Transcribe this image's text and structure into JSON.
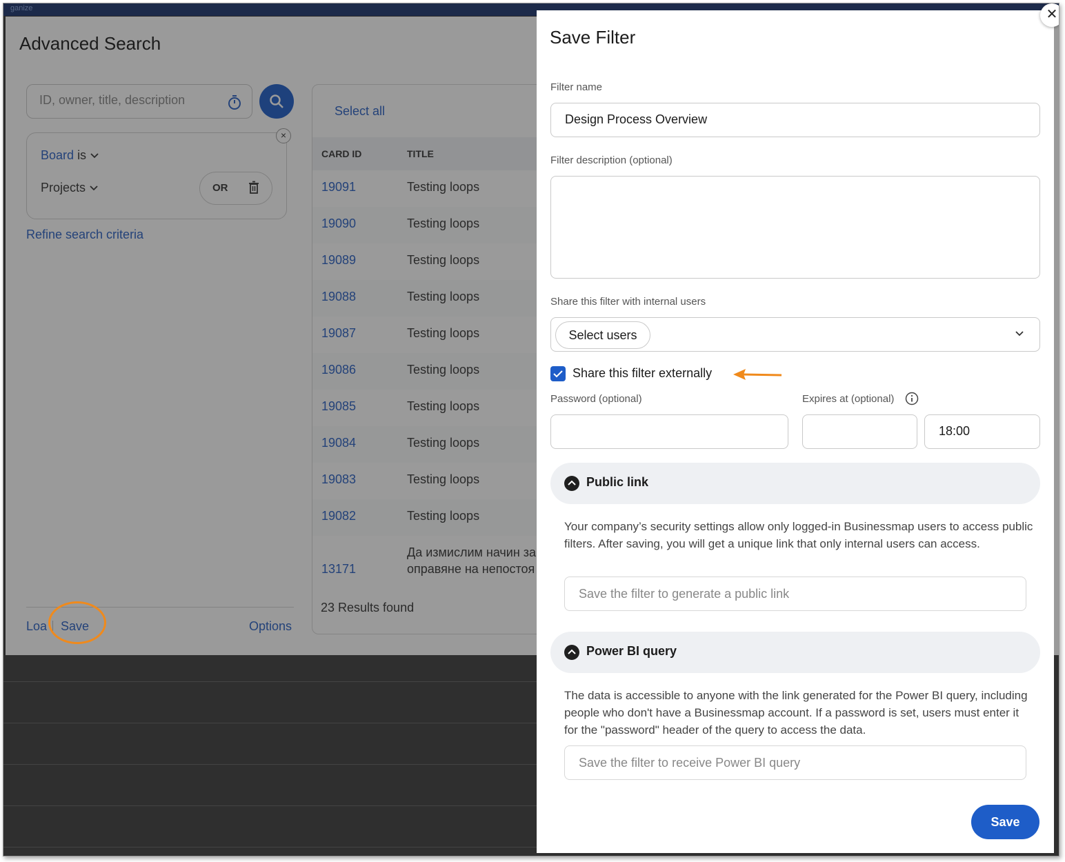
{
  "top_strip": {
    "text": "ganize"
  },
  "advanced_search": {
    "title": "Advanced Search",
    "search_placeholder": "ID, owner, title, description",
    "criteria": {
      "field": "Board",
      "operator": "is",
      "value": "Projects",
      "or_label": "OR"
    },
    "refine_label": "Refine search criteria",
    "footer": {
      "load_label": "Loa",
      "save_label": "Save",
      "options_label": "Options"
    }
  },
  "results": {
    "select_all": "Select all",
    "columns": [
      "CARD ID",
      "TITLE"
    ],
    "rows": [
      {
        "id": "19091",
        "title": "Testing loops"
      },
      {
        "id": "19090",
        "title": "Testing loops"
      },
      {
        "id": "19089",
        "title": "Testing loops"
      },
      {
        "id": "19088",
        "title": "Testing loops"
      },
      {
        "id": "19087",
        "title": "Testing loops"
      },
      {
        "id": "19086",
        "title": "Testing loops"
      },
      {
        "id": "19085",
        "title": "Testing loops"
      },
      {
        "id": "19084",
        "title": "Testing loops"
      },
      {
        "id": "19083",
        "title": "Testing loops"
      },
      {
        "id": "19082",
        "title": "Testing loops"
      }
    ],
    "last_row": {
      "id": "13171",
      "title_line1": "Да измислим начин за",
      "title_line2": "оправяне на непостоя"
    },
    "count": "23 Results found"
  },
  "save_filter": {
    "title": "Save Filter",
    "close_label": "✕",
    "filter_name_label": "Filter name",
    "filter_name_value": "Design Process Overview",
    "description_label": "Filter description (optional)",
    "share_internal_label": "Share this filter with internal users",
    "select_users_label": "Select users",
    "share_external_label": "Share this filter externally",
    "share_external_checked": true,
    "password_label": "Password (optional)",
    "expires_label": "Expires at (optional)",
    "expires_time": "18:00",
    "public_link": {
      "title": "Public link",
      "description": "Your company’s security settings allow only logged-in Businessmap users to access public filters. After saving, you will get a unique link that only internal users can access.",
      "placeholder": "Save the filter to generate a public link"
    },
    "power_bi": {
      "title": "Power BI query",
      "description": "The data is accessible to anyone with the link generated for the Power BI query, including people who don't have a Businessmap account. If a password is set, users must enter it for the \"password\" header of the query to access the data.",
      "placeholder": "Save the filter to receive Power BI query"
    },
    "save_label": "Save"
  },
  "colors": {
    "accent": "#1e5dc8",
    "link": "#2860c4",
    "annotation": "#f08a1c"
  }
}
